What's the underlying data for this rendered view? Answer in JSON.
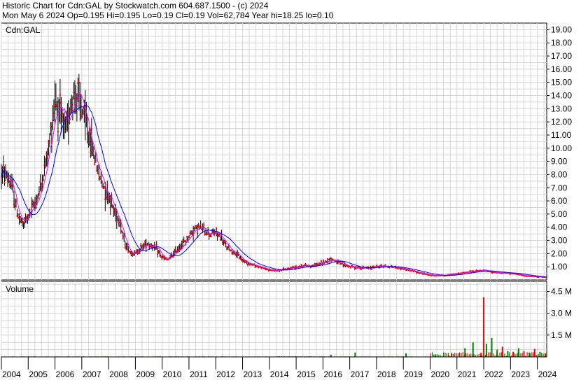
{
  "header": {
    "line1": "Historic Chart for Cdn:GAL by Stockwatch.com 604.687.1500 - (c) 2024",
    "line2": "Mon May  6 2024   Op=0.195  Hi=0.195  Lo=0.19  Cl=0.19  Vol=62,784  Year hi=18.25  lo=0.10"
  },
  "chart_data": [
    {
      "type": "line",
      "title": "Cdn:GAL",
      "ylabel": "",
      "ylim": [
        0,
        19.5
      ],
      "yticks": [
        1,
        2,
        3,
        4,
        5,
        6,
        7,
        8,
        9,
        10,
        11,
        12,
        13,
        14,
        15,
        16,
        17,
        18,
        19
      ],
      "ytick_labels": [
        "1.00",
        "2.00",
        "3.00",
        "4.00",
        "5.00",
        "6.00",
        "7.00",
        "8.00",
        "9.00",
        "10.00",
        "11.00",
        "12.00",
        "13.00",
        "14.00",
        "15.00",
        "16.00",
        "17.00",
        "18.00",
        "19.00"
      ],
      "xlim": [
        2004.0,
        2024.35
      ],
      "xticks": [
        2004,
        2005,
        2006,
        2007,
        2008,
        2009,
        2010,
        2011,
        2012,
        2013,
        2014,
        2015,
        2016,
        2017,
        2018,
        2019,
        2020,
        2021,
        2022,
        2023,
        2024
      ],
      "grid": true,
      "colors": {
        "price_bar": "#000000",
        "close_dots": "#ff0000",
        "ma_short": "#ff00ff",
        "ma_long": "#0000ff"
      },
      "series": [
        {
          "x": [
            2004.0,
            2004.2,
            2004.4,
            2004.6,
            2004.8,
            2005.0,
            2005.2,
            2005.4,
            2005.6,
            2005.8,
            2006.0,
            2006.2,
            2006.4,
            2006.6,
            2006.8,
            2007.0,
            2007.2,
            2007.4,
            2007.6,
            2007.8,
            2008.0,
            2008.2,
            2008.4,
            2008.6,
            2008.8,
            2009.0,
            2009.2,
            2009.4,
            2009.6,
            2009.8,
            2010.0,
            2010.2,
            2010.4,
            2010.6,
            2010.8,
            2011.0,
            2011.2,
            2011.4,
            2011.6,
            2011.8,
            2012.0,
            2012.2,
            2012.4,
            2012.6,
            2012.8,
            2013.0,
            2013.3,
            2013.6,
            2014.0,
            2014.3,
            2014.6,
            2015.0,
            2015.3,
            2015.6,
            2016.0,
            2016.3,
            2016.6,
            2017.0,
            2017.3,
            2017.6,
            2018.0,
            2018.3,
            2018.6,
            2019.0,
            2019.3,
            2019.6,
            2020.0,
            2020.3,
            2020.6,
            2021.0,
            2021.3,
            2021.6,
            2022.0,
            2022.3,
            2022.6,
            2023.0,
            2023.3,
            2023.6,
            2024.0,
            2024.35
          ],
          "values": [
            8.2,
            7.9,
            7.0,
            5.0,
            4.2,
            4.8,
            5.6,
            6.6,
            8.2,
            10.5,
            13.8,
            12.5,
            11.2,
            13.5,
            14.2,
            13.0,
            11.6,
            10.0,
            8.3,
            7.2,
            6.5,
            5.3,
            4.6,
            2.8,
            2.1,
            2.0,
            2.4,
            2.8,
            2.6,
            2.3,
            1.7,
            1.5,
            1.9,
            2.4,
            2.8,
            3.3,
            3.9,
            4.0,
            3.7,
            3.5,
            3.6,
            3.2,
            2.5,
            2.2,
            1.9,
            1.5,
            1.2,
            1.0,
            0.75,
            0.7,
            0.8,
            1.0,
            1.1,
            1.05,
            1.3,
            1.6,
            1.3,
            1.0,
            0.95,
            0.9,
            1.0,
            1.05,
            1.0,
            0.85,
            0.7,
            0.55,
            0.35,
            0.33,
            0.35,
            0.45,
            0.55,
            0.65,
            0.7,
            0.6,
            0.55,
            0.5,
            0.4,
            0.3,
            0.25,
            0.19
          ]
        }
      ]
    },
    {
      "type": "bar",
      "title": "Volume",
      "ylim": [
        0,
        5200000
      ],
      "yticks": [
        1500000,
        3000000,
        4500000
      ],
      "ytick_labels": [
        "1.5 M",
        "3.0 M",
        "4.5 M"
      ],
      "xlim": [
        2004.0,
        2024.35
      ],
      "grid": true,
      "colors": {
        "up": "#008000",
        "down": "#ff0000"
      },
      "x": [
        2016.3,
        2017.2,
        2019.1,
        2020.2,
        2020.8,
        2021.3,
        2021.6,
        2021.9,
        2022.0,
        2022.1,
        2022.3,
        2022.5,
        2022.7,
        2022.9,
        2023.1,
        2023.3,
        2023.5,
        2023.7,
        2023.9,
        2024.1,
        2024.3
      ],
      "values": [
        150000,
        300000,
        250000,
        120000,
        200000,
        600000,
        1000000,
        300000,
        4100000,
        900000,
        1300000,
        500000,
        700000,
        400000,
        350000,
        600000,
        400000,
        300000,
        550000,
        350000,
        250000
      ],
      "up": [
        true,
        true,
        true,
        true,
        true,
        true,
        true,
        false,
        false,
        true,
        true,
        true,
        false,
        true,
        false,
        true,
        false,
        true,
        false,
        true,
        false
      ]
    }
  ]
}
